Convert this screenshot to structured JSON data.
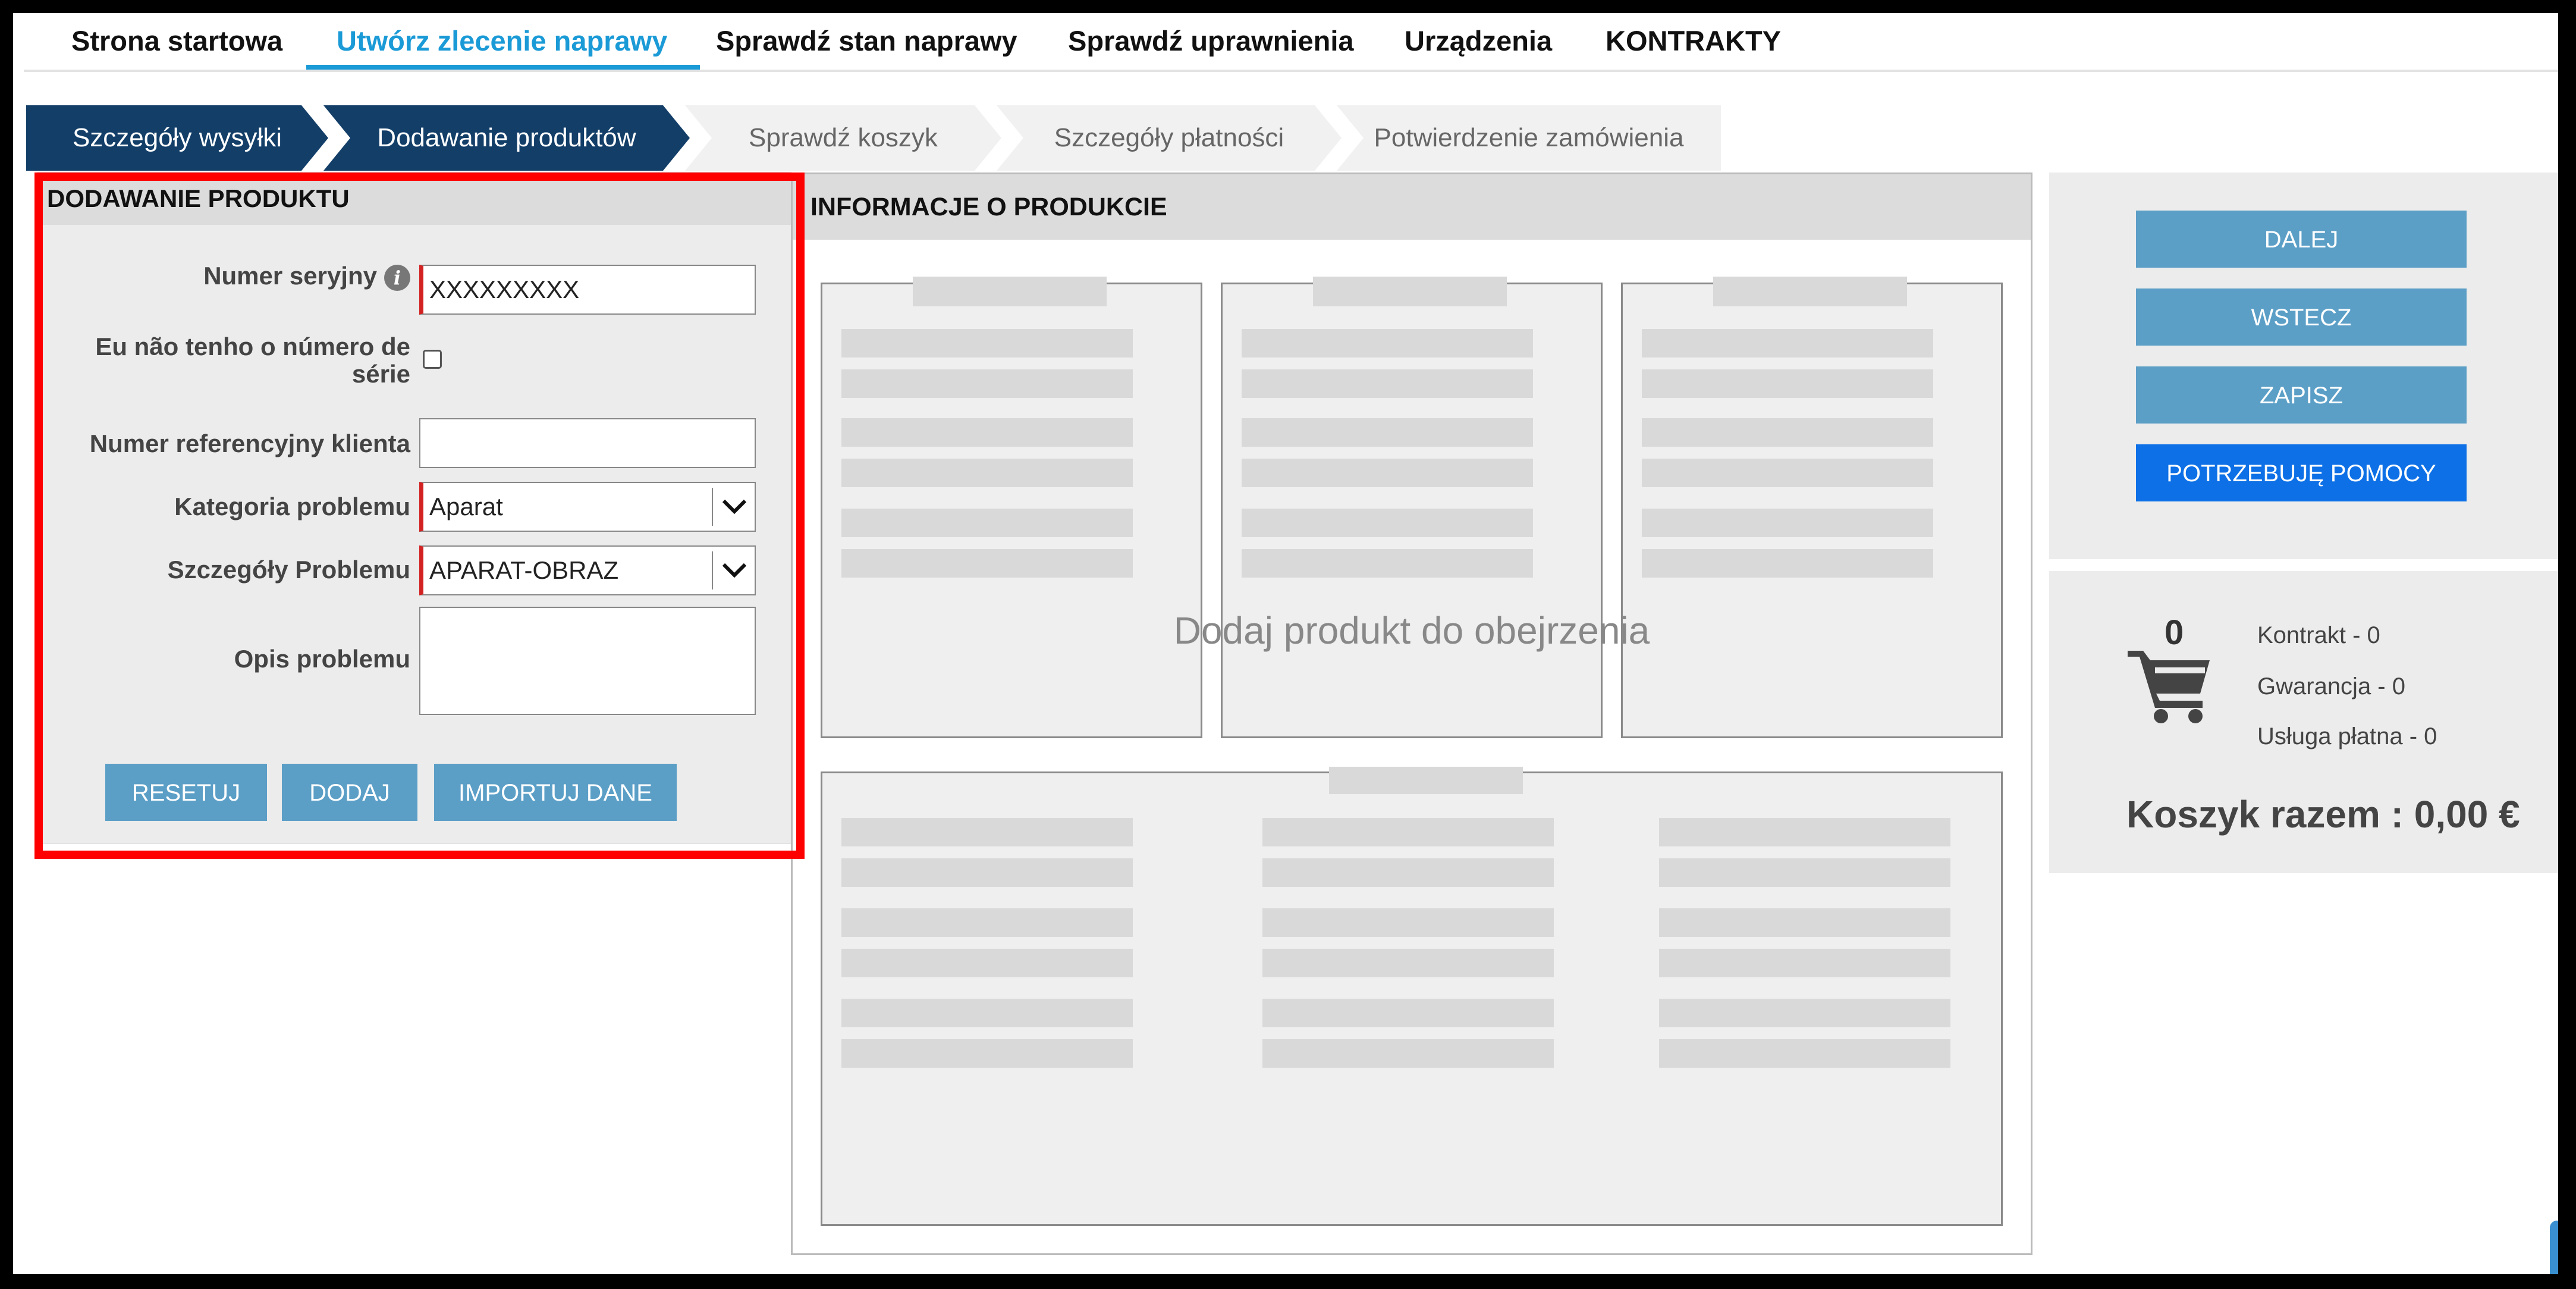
{
  "nav": {
    "items": [
      {
        "label": "Strona startowa"
      },
      {
        "label": "Utwórz zlecenie naprawy"
      },
      {
        "label": "Sprawdź stan naprawy"
      },
      {
        "label": "Sprawdź uprawnienia"
      },
      {
        "label": "Urządzenia"
      },
      {
        "label": "KONTRAKTY"
      }
    ],
    "active_index": 1
  },
  "stepper": {
    "steps": [
      {
        "label": "Szczegóły wysyłki",
        "state": "done"
      },
      {
        "label": "Dodawanie produktów",
        "state": "current"
      },
      {
        "label": "Sprawdź koszyk",
        "state": "todo"
      },
      {
        "label": "Szczegóły płatności",
        "state": "todo"
      },
      {
        "label": "Potwierdzenie zamówienia",
        "state": "todo"
      }
    ]
  },
  "add_product": {
    "title": "DODAWANIE PRODUKTU",
    "serial_label": "Numer seryjny",
    "serial_value": "XXXXXXXXX",
    "no_serial_label_line1": "Eu não tenho o número de",
    "no_serial_label_line2": "série",
    "no_serial_checked": false,
    "client_ref_label": "Numer referencyjny klienta",
    "client_ref_value": "",
    "category_label": "Kategoria problemu",
    "category_value": "Aparat",
    "details_label": "Szczegóły Problemu",
    "details_value": "APARAT-OBRAZ",
    "description_label": "Opis problemu",
    "description_value": "",
    "buttons": {
      "reset": "RESETUJ",
      "add": "DODAJ",
      "import": "IMPORTUJ DANE"
    }
  },
  "product_info": {
    "title": "INFORMACJE O PRODUKCIE",
    "placeholder": "Dodaj produkt do obejrzenia"
  },
  "actions": {
    "next": "DALEJ",
    "back": "WSTECZ",
    "save": "ZAPISZ",
    "help": "POTRZEBUJĘ POMOCY"
  },
  "cart": {
    "count": "0",
    "contract": "Kontrakt - 0",
    "warranty": "Gwarancja - 0",
    "paid": "Usługa płatna - 0",
    "total": "Koszyk razem : 0,00 €"
  },
  "colors": {
    "accent": "#1a9ad6",
    "stepper_done": "#123e68",
    "button": "#5b9fc7",
    "help_button": "#0d70e6",
    "required": "#d32222",
    "highlight": "#ff0000"
  }
}
